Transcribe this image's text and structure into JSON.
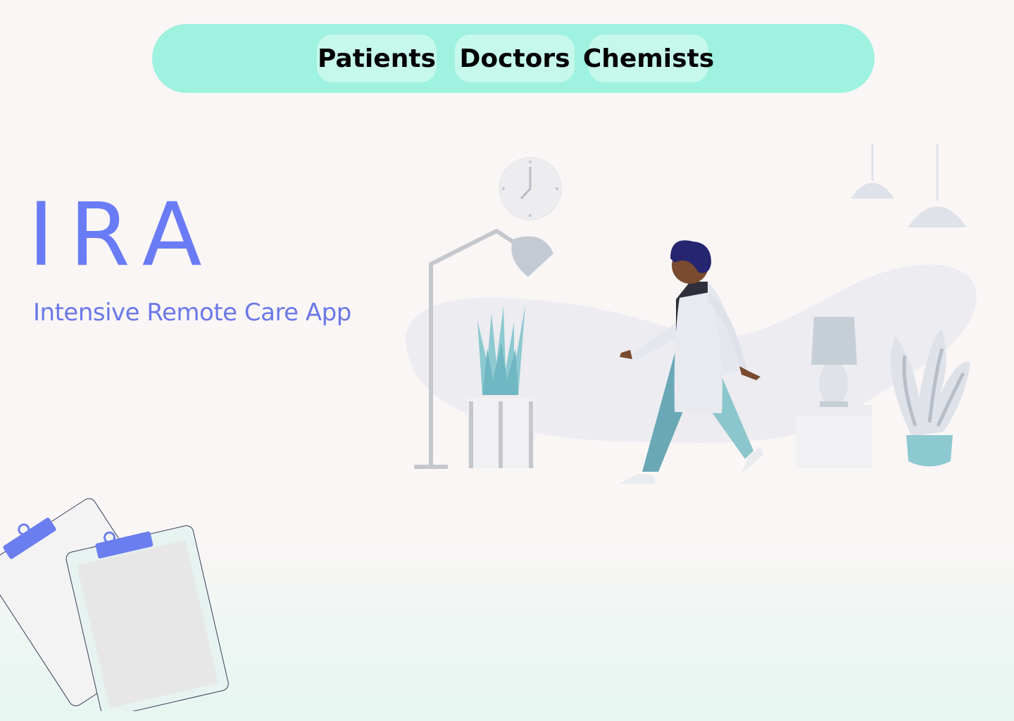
{
  "nav": {
    "patients_label": "Patients",
    "doctors_label": "Doctors",
    "chemists_label": "Chemists"
  },
  "brand": {
    "logo": "IRA",
    "tagline": "Intensive Remote Care App"
  },
  "illustration": {
    "name": "doctor-walking-illustration"
  },
  "decoration": {
    "name": "clipboards-icon"
  },
  "colors": {
    "navbar_bg": "#9ef2df",
    "nav_button_bg": "#c6f8ec",
    "accent": "#6a7cf5",
    "clip": "#6b7ef0"
  }
}
